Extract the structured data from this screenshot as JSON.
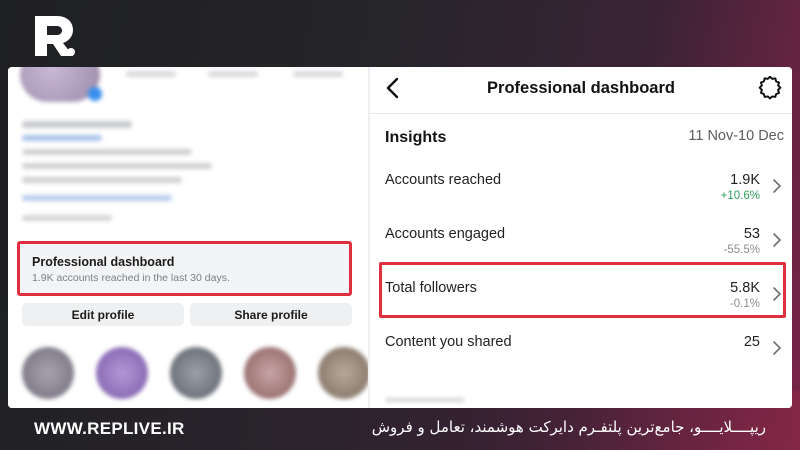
{
  "brand": {
    "logo": "replive-logo",
    "url": "WWW.REPLIVE.IR",
    "tagline": "ریپــــلایــــو، جامع‌ترین پلتفـرم دایرکت هوشمند، تعامل و فروش",
    "accent": "#e0303f"
  },
  "left_panel": {
    "professional_dashboard": {
      "title": "Professional dashboard",
      "subtitle": "1.9K accounts reached in the last 30 days."
    },
    "buttons": {
      "edit": "Edit profile",
      "share": "Share profile"
    }
  },
  "right_panel": {
    "title": "Professional dashboard",
    "back_icon": "chevron-left-icon",
    "settings_icon": "gear-icon",
    "insights_label": "Insights",
    "date_range": "11 Nov-10 Dec",
    "rows": [
      {
        "label": "Accounts reached",
        "value": "1.9K",
        "delta": "+10.6%",
        "delta_color": "#2f9e5b"
      },
      {
        "label": "Accounts engaged",
        "value": "53",
        "delta": "-55.5%",
        "delta_color": "#8a8d92"
      },
      {
        "label": "Total followers",
        "value": "5.8K",
        "delta": "-0.1%",
        "delta_color": "#8a8d92",
        "highlighted": true
      },
      {
        "label": "Content you shared",
        "value": "25",
        "delta": ""
      }
    ]
  }
}
